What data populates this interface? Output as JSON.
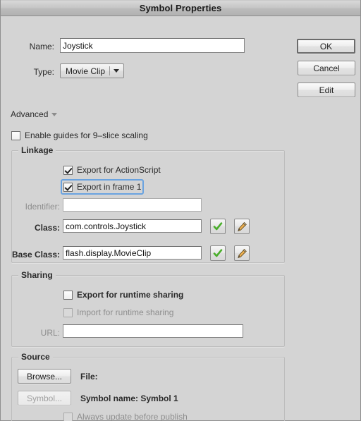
{
  "window": {
    "title": "Symbol Properties"
  },
  "top": {
    "name_label": "Name:",
    "name_value": "Joystick",
    "type_label": "Type:",
    "type_value": "Movie Clip",
    "ok_label": "OK",
    "cancel_label": "Cancel",
    "edit_label": "Edit"
  },
  "advanced": {
    "label": "Advanced",
    "nine_slice_label": "Enable guides for 9–slice scaling",
    "nine_slice_checked": false
  },
  "linkage": {
    "title": "Linkage",
    "export_actionscript_label": "Export for ActionScript",
    "export_actionscript_checked": true,
    "export_frame1_label": "Export in frame 1",
    "export_frame1_checked": true,
    "identifier_label": "Identifier:",
    "identifier_value": "",
    "class_label": "Class:",
    "class_value": "com.controls.Joystick",
    "base_class_label": "Base Class:",
    "base_class_value": "flash.display.MovieClip",
    "validate_icon": "check-icon",
    "edit_icon": "pencil-icon"
  },
  "sharing": {
    "title": "Sharing",
    "export_runtime_label": "Export for runtime sharing",
    "export_runtime_checked": false,
    "import_runtime_label": "Import for runtime sharing",
    "import_runtime_checked": false,
    "url_label": "URL:",
    "url_value": ""
  },
  "source": {
    "title": "Source",
    "browse_label": "Browse...",
    "file_label": "File:",
    "symbol_button_label": "Symbol...",
    "symbol_name_label": "Symbol name: Symbol 1",
    "always_update_label": "Always update before publish",
    "always_update_checked": false
  },
  "colors": {
    "dialog_bg": "#d4d4d4",
    "focus_ring": "#6aa3e0",
    "check_green": "#4aae2b",
    "pencil_orange": "#e8a33d"
  }
}
